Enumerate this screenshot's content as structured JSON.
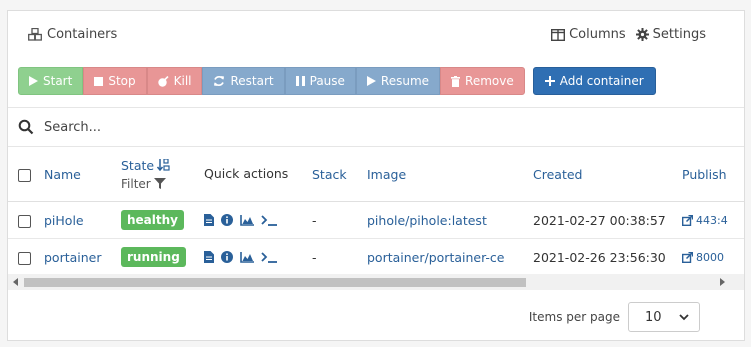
{
  "header": {
    "title": "Containers",
    "columns_label": "Columns",
    "settings_label": "Settings"
  },
  "toolbar": {
    "start": "Start",
    "stop": "Stop",
    "kill": "Kill",
    "restart": "Restart",
    "pause": "Pause",
    "resume": "Resume",
    "remove": "Remove",
    "add": "Add container"
  },
  "search": {
    "placeholder": "Search...",
    "value": ""
  },
  "table": {
    "columns": {
      "name": "Name",
      "state": "State",
      "state_filter": "Filter",
      "quick_actions": "Quick actions",
      "stack": "Stack",
      "image": "Image",
      "created": "Created",
      "published": "Publish"
    },
    "rows": [
      {
        "name": "piHole",
        "state": "healthy",
        "stack": "-",
        "image": "pihole/pihole:latest",
        "created": "2021-02-27 00:38:57",
        "published": "443:4"
      },
      {
        "name": "portainer",
        "state": "running",
        "stack": "-",
        "image": "portainer/portainer-ce",
        "created": "2021-02-26 23:56:30",
        "published": "8000"
      }
    ]
  },
  "pagination": {
    "label": "Items per page",
    "value": "10"
  },
  "colors": {
    "accent": "#2a6099",
    "success": "#5cb85c",
    "danger": "#e89696",
    "primary": "#2f6fb3"
  }
}
